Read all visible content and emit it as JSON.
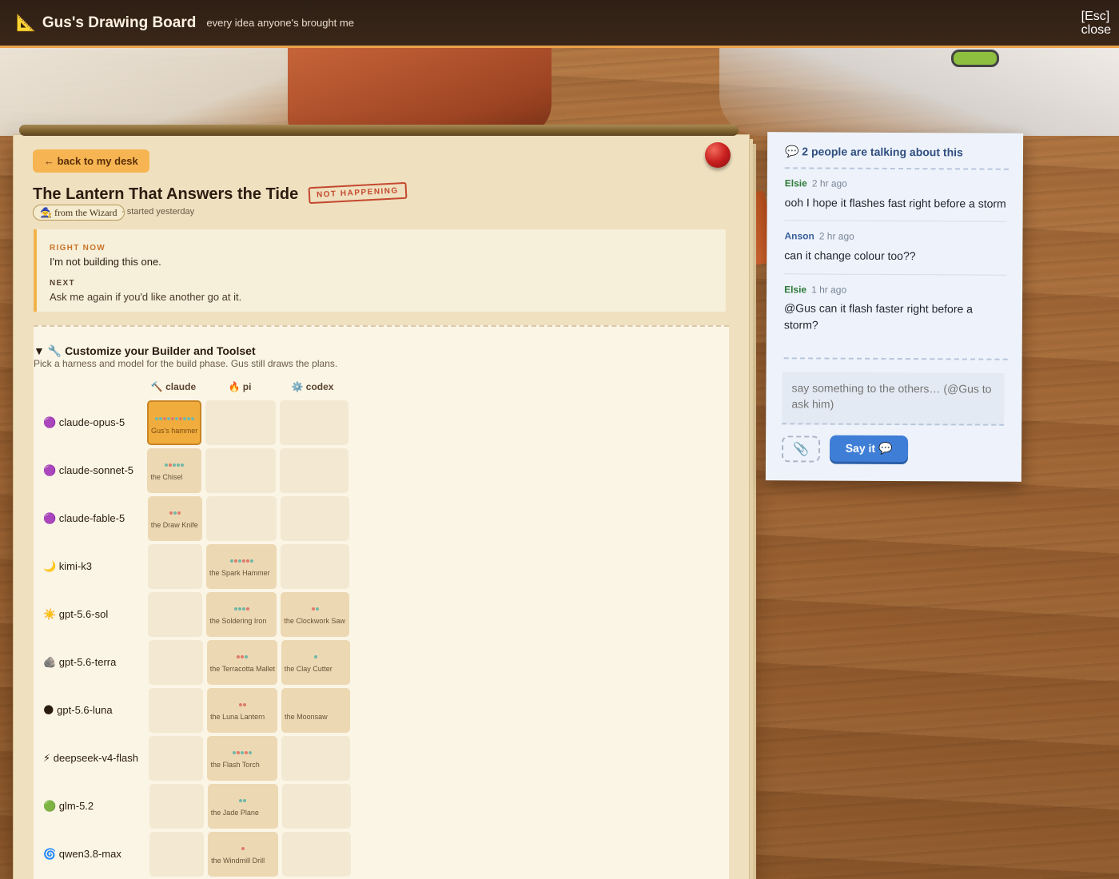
{
  "header": {
    "icon": "triangle-ruler-icon",
    "title": "Gus's Drawing Board",
    "subtitle": "every idea anyone's brought me",
    "esc_key": "[Esc]",
    "esc_label": "close"
  },
  "idea": {
    "back_label": "← back to my desk",
    "title": "The Lantern That Answers the Tide",
    "stamp": "NOT HAPPENING",
    "from_tag": "🧙 from the Wizard",
    "started": "· started yesterday",
    "status": {
      "right_now_label": "RIGHT NOW",
      "right_now_text": "I'm not building this one.",
      "next_label": "NEXT",
      "next_text": "Ask me again if you'd like another go at it."
    }
  },
  "toolset": {
    "title": "▼ 🔧 Customize your Builder and Toolset",
    "subtitle": "Pick a harness and model for the build phase. Gus still draws the plans.",
    "columns": [
      {
        "label": "🔨 claude"
      },
      {
        "label": "🔥 pi"
      },
      {
        "label": "⚙️ codex"
      }
    ],
    "rows": [
      {
        "model": "🟣 claude-opus-5",
        "cells": [
          {
            "tool": "Gus's hammer",
            "dots": [
              "#6fb8a8",
              "#6fb8a8",
              "#e07a6a",
              "#6fb8a8",
              "#e07a6a",
              "#6fb8a8",
              "#e07a6a",
              "#6fb8a8",
              "#6fb8a8",
              "#6fb8a8"
            ],
            "selected": true
          },
          null,
          null
        ]
      },
      {
        "model": "🟣 claude-sonnet-5",
        "cells": [
          {
            "tool": "the Chisel",
            "dots": [
              "#6fb8a8",
              "#e07a6a",
              "#6fb8a8",
              "#6fb8a8",
              "#6fb8a8"
            ]
          },
          null,
          null
        ]
      },
      {
        "model": "🟣 claude-fable-5",
        "cells": [
          {
            "tool": "the Draw Knife",
            "dots": [
              "#e07a6a",
              "#6fb8a8",
              "#e07a6a"
            ]
          },
          null,
          null
        ]
      },
      {
        "model": "🌙 kimi-k3",
        "cells": [
          null,
          {
            "tool": "the Spark Hammer",
            "dots": [
              "#6fb8a8",
              "#e07a6a",
              "#6fb8a8",
              "#e07a6a",
              "#e07a6a",
              "#6fb8a8"
            ]
          },
          null
        ]
      },
      {
        "model": "☀️ gpt-5.6-sol",
        "cells": [
          null,
          {
            "tool": "the Soldering Iron",
            "dots": [
              "#6fb8a8",
              "#6fb8a8",
              "#6fb8a8",
              "#e07a6a"
            ]
          },
          {
            "tool": "the Clockwork Saw",
            "dots": [
              "#e07a6a",
              "#6fb8a8"
            ]
          }
        ]
      },
      {
        "model": "🪨 gpt-5.6-terra",
        "cells": [
          null,
          {
            "tool": "the Terracotta Mallet",
            "dots": [
              "#e07a6a",
              "#e07a6a",
              "#6fb8a8"
            ]
          },
          {
            "tool": "the Clay Cutter",
            "dots": [
              "#6fb8a8"
            ]
          }
        ]
      },
      {
        "model": "🌑 gpt-5.6-luna",
        "cells": [
          null,
          {
            "tool": "the Luna Lantern",
            "dots": [
              "#e07a6a",
              "#e07a6a"
            ]
          },
          {
            "tool": "the Moonsaw",
            "dots": []
          }
        ]
      },
      {
        "model": "⚡ deepseek-v4-flash",
        "cells": [
          null,
          {
            "tool": "the Flash Torch",
            "dots": [
              "#6fb8a8",
              "#e07a6a",
              "#6fb8a8",
              "#e07a6a",
              "#6fb8a8"
            ]
          },
          null
        ]
      },
      {
        "model": "🟢 glm-5.2",
        "cells": [
          null,
          {
            "tool": "the Jade Plane",
            "dots": [
              "#6fb8a8",
              "#6fb8a8"
            ]
          },
          null
        ]
      },
      {
        "model": "🌀 qwen3.8-max",
        "cells": [
          null,
          {
            "tool": "the Windmill Drill",
            "dots": [
              "#e07a6a"
            ]
          },
          null
        ]
      }
    ]
  },
  "chat": {
    "heading": "💬 2 people are talking about this",
    "messages": [
      {
        "author": "Elsie",
        "time": "2 hr ago",
        "text": "ooh I hope it flashes fast right before a storm",
        "color": "#2f7a3a"
      },
      {
        "author": "Anson",
        "time": "2 hr ago",
        "text": "can it change colour too??",
        "color": "#3a5f9a"
      },
      {
        "author": "Elsie",
        "time": "1 hr ago",
        "text": "@Gus can it flash faster right before a storm?",
        "color": "#2f7a3a"
      }
    ],
    "input_placeholder": "say something to the others… (@Gus to ask him)",
    "attach_icon": "paperclip-icon",
    "say_label": "Say it 💬"
  }
}
